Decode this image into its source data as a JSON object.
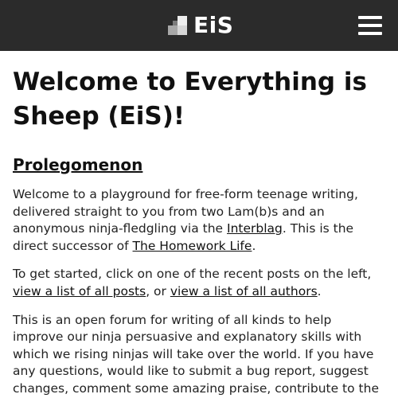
{
  "header": {
    "brand_name": "EiS",
    "logo_icon": "eis-logo-icon",
    "menu_icon": "hamburger-menu-icon",
    "background_color": "#2b2b2b"
  },
  "main": {
    "title": "Welcome to Everything is Sheep (EiS)!",
    "section_heading": "Prolegomenon",
    "paragraph1": {
      "text_before_link": "Welcome to a playground for free-form teenage writing, delivered straight to you from two Lam(b)s and an anonymous ninja-fledgling via the ",
      "link_interblag": "Interblag",
      "text_middle": ". This is the direct successor of ",
      "link_homework_life": "The Homework Life",
      "text_end": "."
    },
    "paragraph2": {
      "text_before": "To get started, click on one of the recent posts on the left, ",
      "link_all_posts": "view a list of all posts",
      "text_between": ", or ",
      "link_all_authors": "view a list of all authors",
      "text_end": "."
    },
    "paragraph3": {
      "text_before": "This is an open forum for writing of all kinds to help improve our ninja persuasive and explanatory skills with which we rising ninjas will take over the world. If you have any questions, would like to submit a bug report, suggest changes, comment some amazing praise, contribute to the blog, or"
    }
  }
}
